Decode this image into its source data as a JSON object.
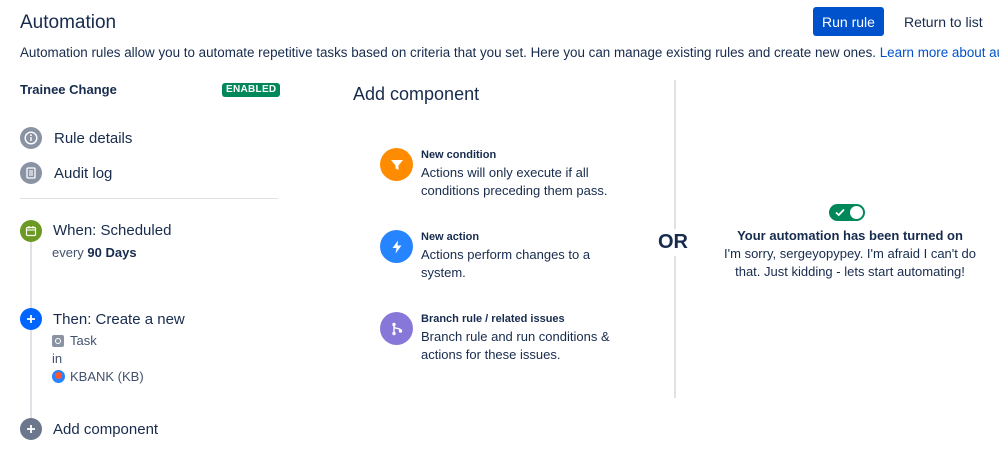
{
  "header": {
    "title": "Automation",
    "run_rule": "Run rule",
    "return_to_list": "Return to list"
  },
  "description": {
    "text": "Automation rules allow you to automate repetitive tasks based on criteria that you set. Here you can manage existing rules and create new ones.",
    "link": "Learn more about automat"
  },
  "rule": {
    "name": "Trainee Change",
    "status": "ENABLED",
    "status_color": "#00875a"
  },
  "nav": {
    "rule_details": "Rule details",
    "audit_log": "Audit log"
  },
  "steps": {
    "when": {
      "title": "When: Scheduled",
      "prefix": "every",
      "value": "90 Days",
      "icon": "calendar-icon",
      "color": "#6a9a23"
    },
    "then": {
      "title": "Then: Create a new",
      "issue_type": "Task",
      "in": "in",
      "project": "KBANK (KB)",
      "icon": "plus-icon",
      "color": "#0065ff"
    },
    "add": {
      "label": "Add component",
      "icon": "plus-icon"
    }
  },
  "add_component": {
    "title": "Add component",
    "items": [
      {
        "name": "New condition",
        "desc": "Actions will only execute if all conditions preceding them pass.",
        "icon": "filter-icon",
        "color": "#ff8b00"
      },
      {
        "name": "New action",
        "desc": "Actions perform changes to a system.",
        "icon": "lightning-icon",
        "color": "#2684ff"
      },
      {
        "name": "Branch rule / related issues",
        "desc": "Branch rule and run conditions & actions for these issues.",
        "icon": "branch-icon",
        "color": "#8777d9"
      }
    ]
  },
  "right_panel": {
    "or": "OR",
    "toggle_on": true,
    "title": "Your automation has been turned on",
    "body": "I'm sorry, sergeyopypey. I'm afraid I can't do that. Just kidding - lets start automating!"
  },
  "colors": {
    "primary": "#0052cc",
    "text": "#172b4d"
  }
}
